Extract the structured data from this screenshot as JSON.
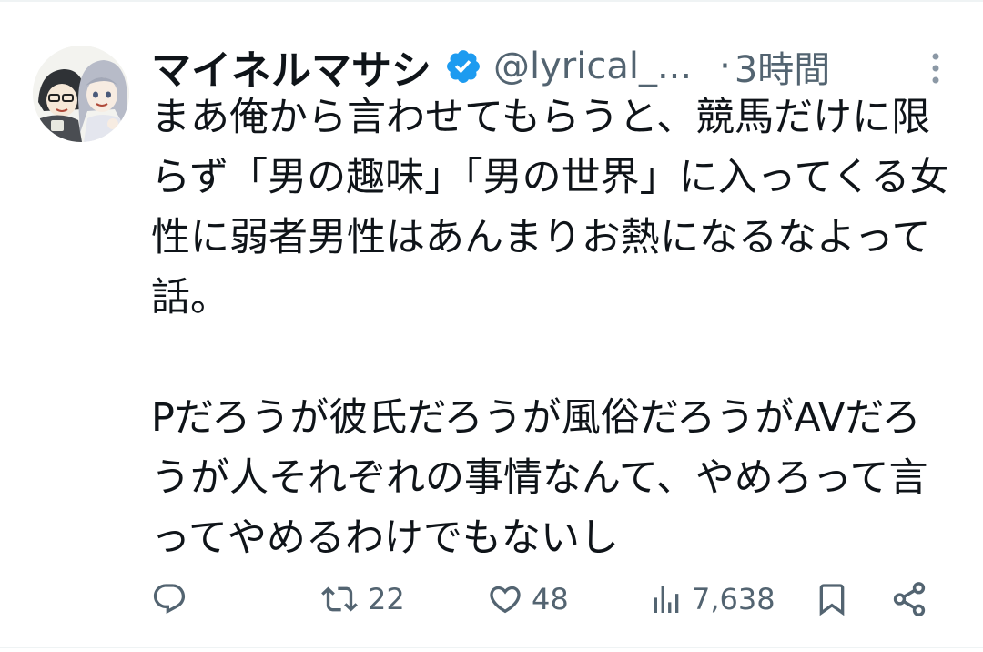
{
  "tweet": {
    "display_name": "マイネルマサシ",
    "handle": "@lyrical_...",
    "separator": "·",
    "timestamp": "3時間",
    "verified": true,
    "verified_color": "#1d9bf0",
    "text": "まあ俺から言わせてもらうと、競馬だけに限らず「男の趣味」「男の世界」に入ってくる女性に弱者男性はあんまりお熱になるなよって話。\n\nPだろうが彼氏だろうが風俗だろうがAVだろうが人それぞれの事情なんて、やめろって言ってやめるわけでもないし"
  },
  "actions": {
    "reply_icon": "reply-icon",
    "retweet_icon": "retweet-icon",
    "retweet_count": "22",
    "like_icon": "heart-icon",
    "like_count": "48",
    "views_icon": "views-icon",
    "views_count": "7,638",
    "bookmark_icon": "bookmark-icon",
    "share_icon": "share-icon"
  },
  "colors": {
    "text_primary": "#0f1419",
    "text_secondary": "#536471",
    "background": "#ffffff"
  }
}
